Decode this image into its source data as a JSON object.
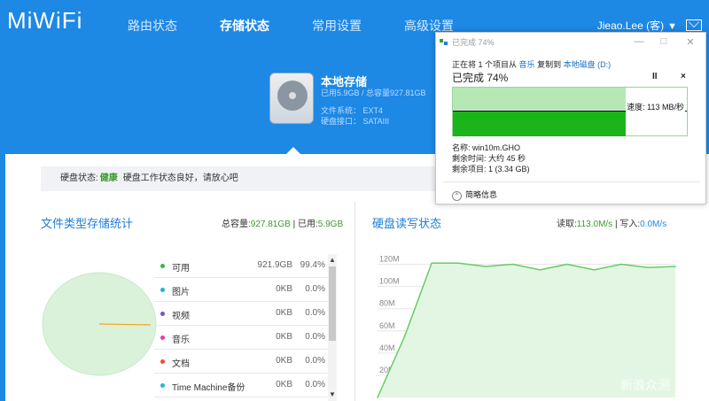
{
  "brand": {
    "logo": "MiWiFi"
  },
  "nav": {
    "items": [
      "路由状态",
      "存储状态",
      "常用设置",
      "高级设置"
    ],
    "active": "存储状态"
  },
  "user": {
    "name": "Jieao.Lee (客)"
  },
  "storage": {
    "title": "本地存储",
    "usage": "已用5.9GB / 总容量927.81GB",
    "fs": "文件系统： EXT4",
    "port": "硬盘接口： SATAIII"
  },
  "health": {
    "label": "硬盘状态:",
    "status": "健康",
    "desc": "硬盘工作状态良好，请放心吧"
  },
  "file_stats": {
    "title": "文件类型存储统计",
    "total_label": "总容量:",
    "total_value": "927.81GB",
    "used_label": "| 已用:",
    "used_value": "5.9GB",
    "rows": [
      {
        "name": "可用",
        "size": "921.9GB",
        "pct": "99.4%",
        "color": "#39b54a"
      },
      {
        "name": "图片",
        "size": "0KB",
        "pct": "0.0%",
        "color": "#23aee0"
      },
      {
        "name": "视频",
        "size": "0KB",
        "pct": "0.0%",
        "color": "#7b4fd0"
      },
      {
        "name": "音乐",
        "size": "0KB",
        "pct": "0.0%",
        "color": "#e73aa5"
      },
      {
        "name": "文档",
        "size": "0KB",
        "pct": "0.0%",
        "color": "#f04b3c"
      },
      {
        "name": "Time Machine备份",
        "size": "0KB",
        "pct": "0.0%",
        "color": "#23b9c9"
      }
    ]
  },
  "rw": {
    "title": "硬盘读写状态",
    "read_label": "读取:",
    "read_value": "113.0M/s",
    "write_label": "| 写入:",
    "write_value": "0.0M/s"
  },
  "chart_data": {
    "type": "area",
    "y_ticks": [
      "120M",
      "100M",
      "80M",
      "60M",
      "40M",
      "20M"
    ],
    "ylim": [
      0,
      130
    ],
    "values": [
      0,
      55,
      121,
      121,
      118,
      120,
      115,
      120,
      115,
      120,
      117,
      118
    ],
    "color": "#66cc66",
    "fill": "#e3f6e3",
    "grid": true
  },
  "copy_dialog": {
    "title": "已完成 74%",
    "line1_prefix": "正在将 1 个项目从",
    "line1_src": "音乐",
    "line1_mid": "复制到",
    "line1_dst": "本地磁盘 (D:)",
    "progress_text": "已完成 74%",
    "progress": 0.74,
    "speed": "速度: 113 MB/秒",
    "name": "名称: win10m.GHO",
    "remaining_time": "剩余时间: 大约 45 秒",
    "remaining_items": "剩余项目: 1 (3.34 GB)",
    "details": "简略信息",
    "pause": "II",
    "cancel": "×"
  },
  "watermark": "新浪众测"
}
